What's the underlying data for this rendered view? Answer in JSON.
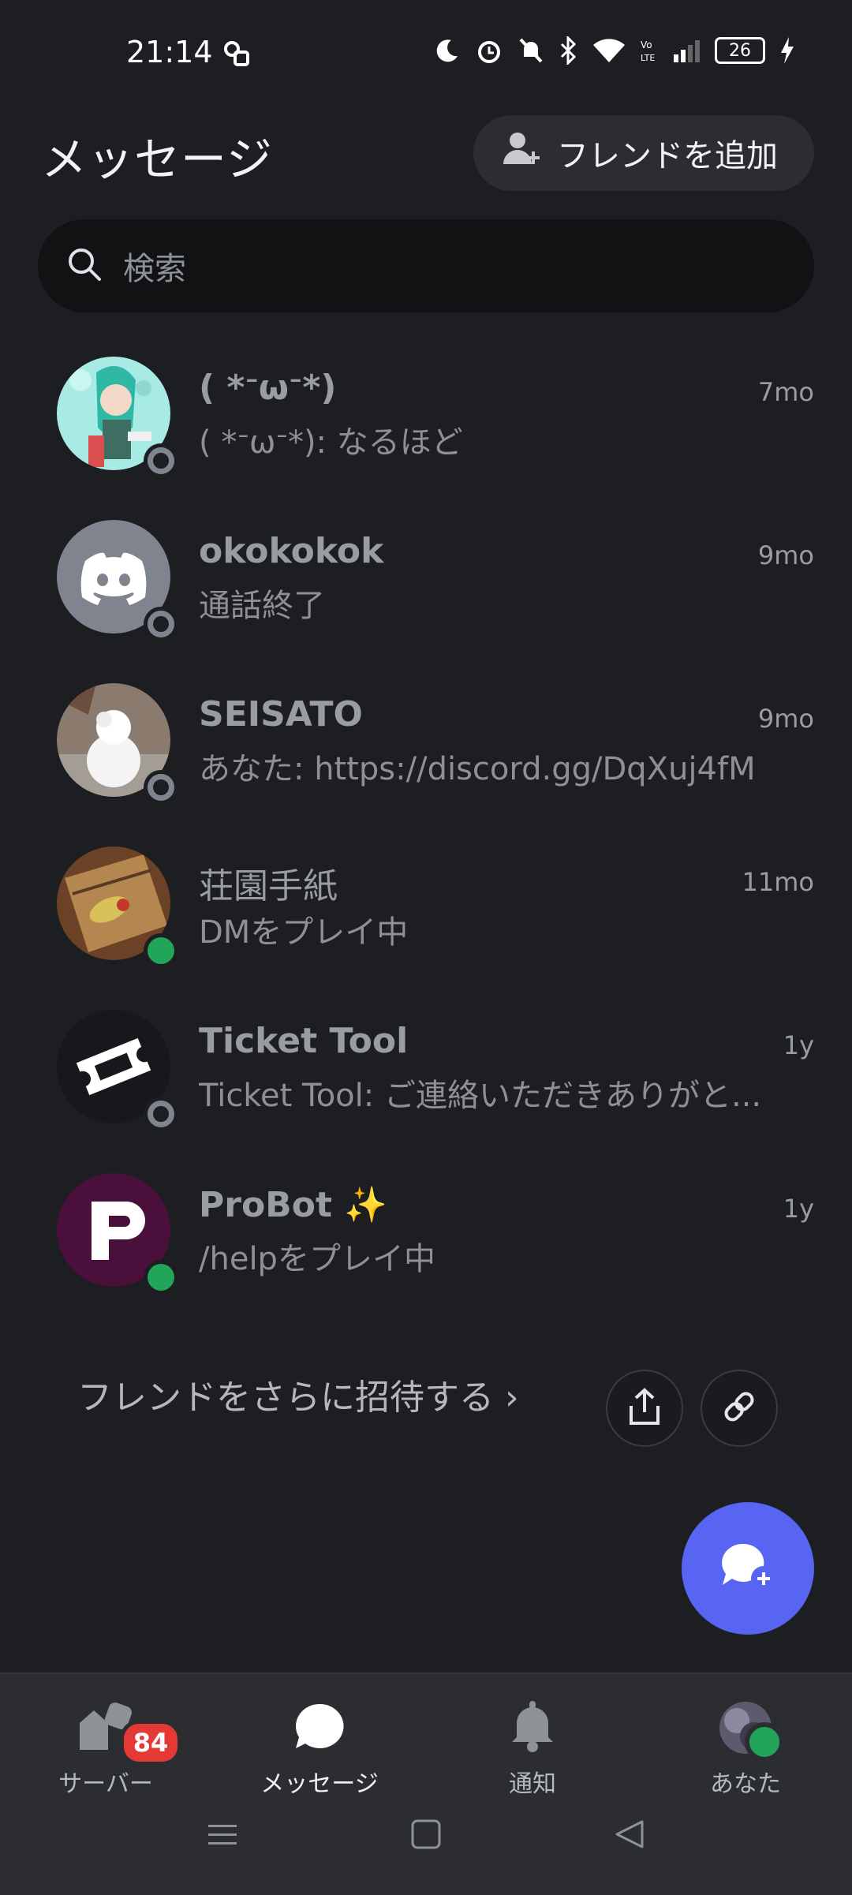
{
  "status_bar": {
    "time": "21:14",
    "battery": "26",
    "icons": [
      "vpn-key-icon",
      "moon-icon",
      "alarm-icon",
      "bell-off-icon",
      "bluetooth-icon",
      "wifi-icon",
      "volte-icon",
      "signal-icon",
      "battery-icon",
      "charging-icon"
    ]
  },
  "header": {
    "title": "メッセージ",
    "add_friend_label": "フレンドを追加"
  },
  "search": {
    "placeholder": "検索"
  },
  "dms": [
    {
      "name": "(  *ᐨωᐨ*)",
      "time": "7mo",
      "message": "(  *ᐨωᐨ*): なるほど",
      "status": "offline",
      "avatar": "anime-avatar"
    },
    {
      "name": "okokokok",
      "time": "9mo",
      "message": "通話終了",
      "status": "offline",
      "avatar": "discord-default-avatar"
    },
    {
      "name": "SEISATO",
      "time": "9mo",
      "message": "あなた: https://discord.gg/DqXuj4fM",
      "status": "offline",
      "avatar": "snowman-avatar"
    },
    {
      "name": "荘園手紙",
      "time": "11mo",
      "message": "DMをプレイ中",
      "status": "online",
      "avatar": "letter-avatar"
    },
    {
      "name": "Ticket Tool",
      "time": "1y",
      "message": "Ticket Tool: ご連絡いただきありがと...",
      "status": "offline",
      "avatar": "ticket-avatar"
    },
    {
      "name": "ProBot ✨",
      "time": "1y",
      "message": "/helpをプレイ中",
      "status": "online",
      "avatar": "probot-avatar"
    }
  ],
  "invite": {
    "label": "フレンドをさらに招待する ›"
  },
  "bottom_nav": {
    "items": [
      {
        "label": "サーバー",
        "badge": "84",
        "icon": "servers-icon"
      },
      {
        "label": "メッセージ",
        "icon": "messages-icon",
        "active": true
      },
      {
        "label": "通知",
        "icon": "bell-icon"
      },
      {
        "label": "あなた",
        "icon": "profile-avatar"
      }
    ]
  },
  "colors": {
    "background": "#1d1e22",
    "accent": "#5865f2",
    "online": "#23a559",
    "badge": "#e53935"
  }
}
